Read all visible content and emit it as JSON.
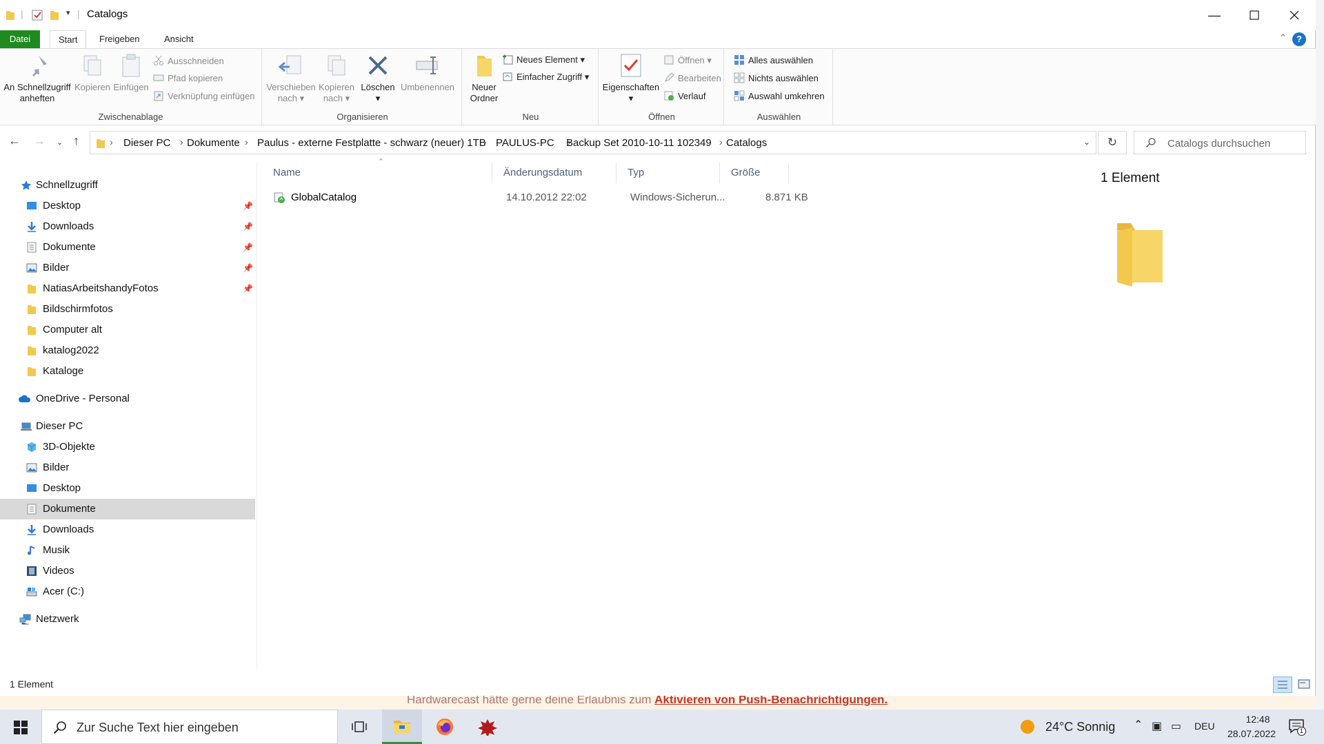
{
  "window": {
    "title": "Catalogs"
  },
  "ribbon_tabs": {
    "datei": "Datei",
    "start": "Start",
    "freigeben": "Freigeben",
    "ansicht": "Ansicht"
  },
  "ribbon": {
    "zwischenablage": {
      "label": "Zwischenablage",
      "pin_line1": "An Schnellzugriff",
      "pin_line2": "anheften",
      "copy": "Kopieren",
      "paste": "Einfügen",
      "cut": "Ausschneiden",
      "copy_path": "Pfad kopieren",
      "paste_shortcut": "Verknüpfung einfügen"
    },
    "organisieren": {
      "label": "Organisieren",
      "move_line1": "Verschieben",
      "move_line2": "nach",
      "copyto_line1": "Kopieren",
      "copyto_line2": "nach",
      "delete": "Löschen",
      "rename": "Umbenennen"
    },
    "neu": {
      "label": "Neu",
      "new_folder_line1": "Neuer",
      "new_folder_line2": "Ordner",
      "new_item": "Neues Element",
      "easy_access": "Einfacher Zugriff"
    },
    "oeffnen": {
      "label": "Öffnen",
      "properties": "Eigenschaften",
      "open": "Öffnen",
      "edit": "Bearbeiten",
      "history": "Verlauf"
    },
    "auswaehlen": {
      "label": "Auswählen",
      "select_all": "Alles auswählen",
      "select_none": "Nichts auswählen",
      "invert": "Auswahl umkehren"
    }
  },
  "address": {
    "crumbs": [
      "Dieser PC",
      "Dokumente",
      "Paulus - externe Festplatte - schwarz (neuer) 1TB",
      "PAULUS-PC",
      "Backup Set 2010-10-11 102349",
      "Catalogs"
    ]
  },
  "search": {
    "placeholder": "Catalogs durchsuchen"
  },
  "nav": {
    "quick_access": "Schnellzugriff",
    "quick_items": [
      "Desktop",
      "Downloads",
      "Dokumente",
      "Bilder",
      "NatiasArbeitshandyFotos",
      "Bildschirmfotos",
      "Computer alt",
      "katalog2022",
      "Kataloge"
    ],
    "onedrive": "OneDrive - Personal",
    "this_pc": "Dieser PC",
    "pc_items": [
      "3D-Objekte",
      "Bilder",
      "Desktop",
      "Dokumente",
      "Downloads",
      "Musik",
      "Videos",
      "Acer (C:)"
    ],
    "network": "Netzwerk"
  },
  "columns": {
    "name": "Name",
    "date": "Änderungsdatum",
    "type": "Typ",
    "size": "Größe"
  },
  "files": [
    {
      "name": "GlobalCatalog",
      "date": "14.10.2012 22:02",
      "type": "Windows-Sicherun...",
      "size": "8.871 KB"
    }
  ],
  "details": {
    "count": "1 Element"
  },
  "status": {
    "count": "1 Element"
  },
  "background_notice": {
    "text": "Hardwarecast hätte gerne deine Erlaubnis zum ",
    "link": "Aktivieren von Push-Benachrichtigungen."
  },
  "taskbar": {
    "search_placeholder": "Zur Suche Text hier eingeben",
    "weather": "24°C  Sonnig",
    "language": "DEU",
    "time": "12:48",
    "date": "28.07.2022",
    "notification_count": "1"
  },
  "colors": {
    "accent_green": "#1f8a1f",
    "folder_yellow": "#f3c94d",
    "selected_bg": "#d9d9d9",
    "header_text": "#4c607a"
  }
}
